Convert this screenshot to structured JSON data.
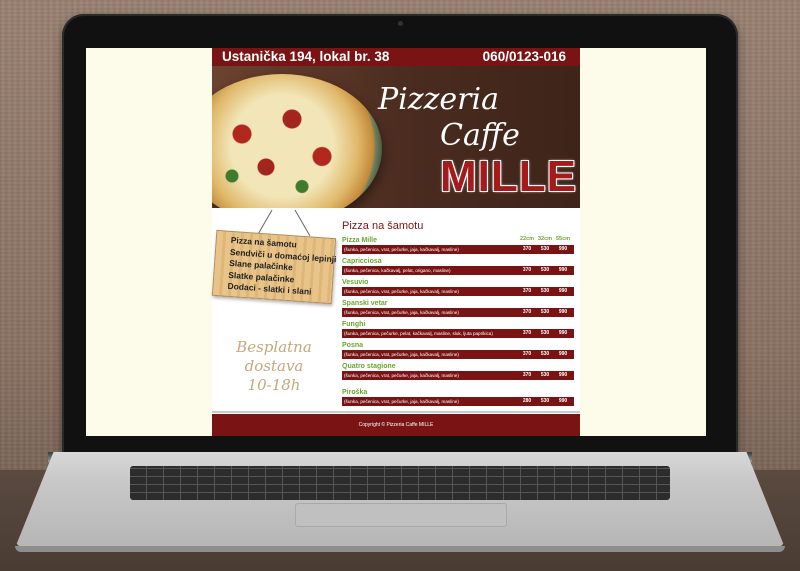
{
  "header": {
    "address": "Ustanička 194, lokal br. 38",
    "phone": "060/0123-016",
    "brand_line1": "Pizzeria",
    "brand_line2": "Caffe",
    "brand_line3": "MILLE"
  },
  "nav": {
    "items": [
      {
        "label": "Pizza na šamotu"
      },
      {
        "label": "Sendviči u domaćoj lepinji"
      },
      {
        "label": "Slane palačinke"
      },
      {
        "label": "Slatke palačinke"
      },
      {
        "label": "Dodaci - slatki i slani"
      }
    ]
  },
  "delivery": {
    "line1": "Besplatna dostava",
    "line2": "10-18h"
  },
  "menu": {
    "title": "Pizza na šamotu",
    "sizes": [
      "22cm",
      "32cm",
      "55cm"
    ],
    "items": [
      {
        "name": "Pizza Mille",
        "desc": "(šunka, pečenica, vrat, pečurke, jaja, kačkavalj, masline)",
        "prices": [
          "370",
          "530",
          "990"
        ]
      },
      {
        "name": "Capricciosa",
        "desc": "(šunka, pečenica, kačkavalj, pelat, origano, masline)",
        "prices": [
          "370",
          "530",
          "990"
        ]
      },
      {
        "name": "Vesuvio",
        "desc": "(šunka, pečenica, vrat, pečurke, jaja, kačkavalj, masline)",
        "prices": [
          "370",
          "530",
          "990"
        ]
      },
      {
        "name": "Spanski vetar",
        "desc": "(šunka, pečenica, vrat, pečurke, jaja, kačkavalj, masline)",
        "prices": [
          "370",
          "530",
          "990"
        ]
      },
      {
        "name": "Funghi",
        "desc": "(šunka, pečenica, pečurke, pelat, kačkavalj, masline, sluk, ljuta paprikica)",
        "prices": [
          "370",
          "530",
          "990"
        ]
      },
      {
        "name": "Posna",
        "desc": "(šunka, pečenica, vrat, pečurke, jaja, kačkavalj, masline)",
        "prices": [
          "370",
          "530",
          "990"
        ]
      },
      {
        "name": "Quatro stagione",
        "desc": "(šunka, pečenica, vrat, pečurke, jaja, kačkavalj, masline)",
        "prices": [
          "370",
          "530",
          "990"
        ]
      },
      {
        "name": "Piroška",
        "desc": "(šunka, pečenica, vrat, pečurke, jaja, kačkavalj, masline)",
        "prices": [
          "280",
          "530",
          "990"
        ]
      }
    ]
  },
  "footer": {
    "copyright": "Copyright © Pizzeria Caffe MILLE"
  },
  "colors": {
    "accent": "#7a1414",
    "item_name": "#6aa62e",
    "page_bg": "#fdfbe9"
  }
}
